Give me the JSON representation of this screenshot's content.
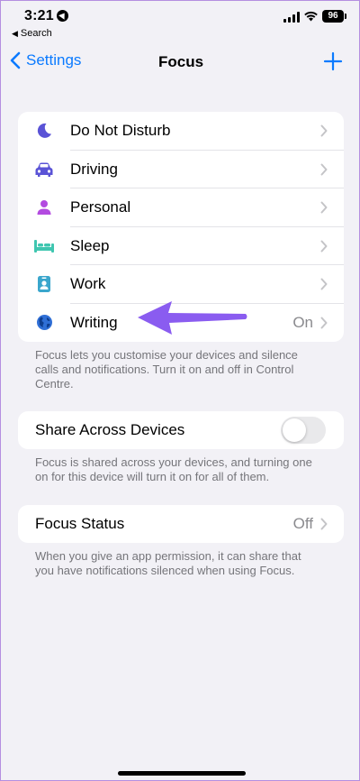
{
  "status": {
    "time": "3:21",
    "back_app": "Search",
    "battery": "96"
  },
  "nav": {
    "back_label": "Settings",
    "title": "Focus"
  },
  "modes": [
    {
      "label": "Do Not Disturb",
      "icon": "moon-icon",
      "color": "#5a53d6",
      "value": ""
    },
    {
      "label": "Driving",
      "icon": "car-icon",
      "color": "#5a53d6",
      "value": ""
    },
    {
      "label": "Personal",
      "icon": "person-icon",
      "color": "#b34be0",
      "value": ""
    },
    {
      "label": "Sleep",
      "icon": "bed-icon",
      "color": "#3fc6b0",
      "value": ""
    },
    {
      "label": "Work",
      "icon": "id-badge-icon",
      "color": "#3aa6cc",
      "value": ""
    },
    {
      "label": "Writing",
      "icon": "globe-icon",
      "color": "#2f6fd6",
      "value": "On"
    }
  ],
  "modes_footer": "Focus lets you customise your devices and silence calls and notifications. Turn it on and off in Control Centre.",
  "share": {
    "label": "Share Across Devices",
    "enabled": false,
    "footer": "Focus is shared across your devices, and turning one on for this device will turn it on for all of them."
  },
  "focus_status": {
    "label": "Focus Status",
    "value": "Off",
    "footer": "When you give an app permission, it can share that you have notifications silenced when using Focus."
  },
  "colors": {
    "accent": "#0a7aff",
    "annotation_arrow": "#8a5cf0",
    "background": "#f2f1f6"
  }
}
